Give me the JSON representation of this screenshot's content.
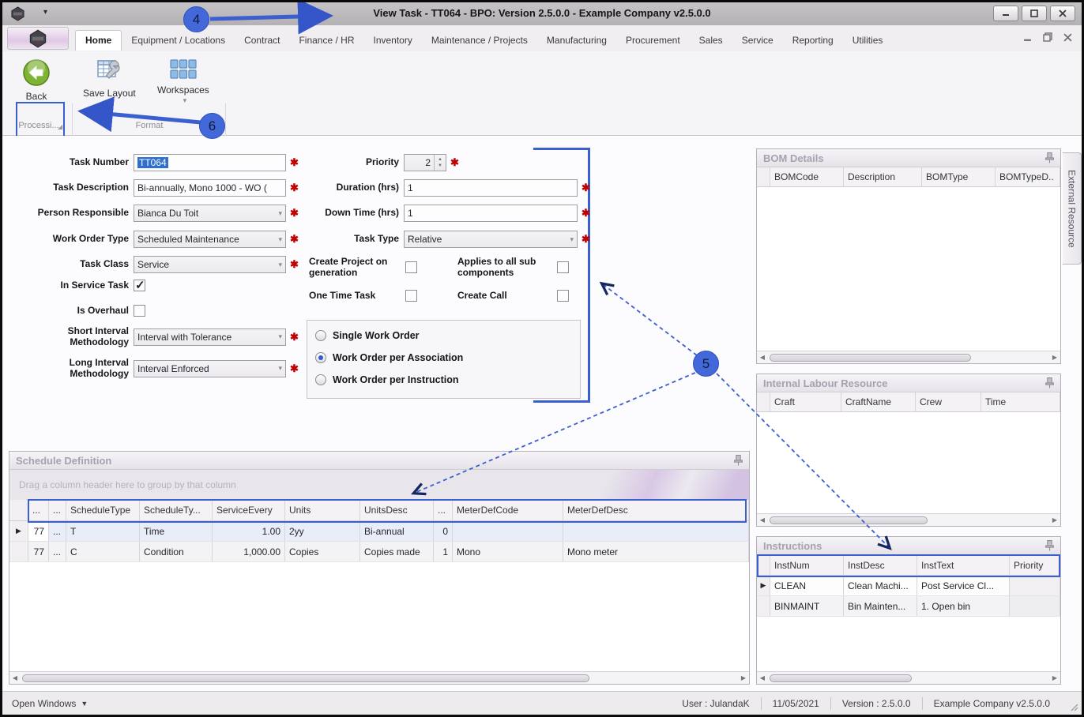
{
  "window": {
    "title": "View Task - TT064 - BPO: Version 2.5.0.0 - Example Company v2.5.0.0",
    "external_tab": "External Resource"
  },
  "tabs": {
    "items": [
      "Home",
      "Equipment / Locations",
      "Contract",
      "Finance / HR",
      "Inventory",
      "Maintenance / Projects",
      "Manufacturing",
      "Procurement",
      "Sales",
      "Service",
      "Reporting",
      "Utilities"
    ],
    "active": "Home"
  },
  "ribbon": {
    "back": "Back",
    "save_layout": "Save Layout",
    "workspaces": "Workspaces",
    "group_processing": "Processi...",
    "group_format": "Format"
  },
  "callouts": {
    "c4": "4",
    "c5": "5",
    "c6": "6"
  },
  "form": {
    "task_number": {
      "label": "Task Number",
      "value": "TT064"
    },
    "task_description": {
      "label": "Task Description",
      "value": "Bi-annually, Mono 1000 - WO ("
    },
    "person_responsible": {
      "label": "Person Responsible",
      "value": "Bianca Du Toit"
    },
    "work_order_type": {
      "label": "Work Order Type",
      "value": "Scheduled Maintenance"
    },
    "task_class": {
      "label": "Task Class",
      "value": "Service"
    },
    "in_service_task": {
      "label": "In Service Task",
      "checked": true
    },
    "is_overhaul": {
      "label": "Is Overhaul",
      "checked": false
    },
    "short_interval": {
      "label": "Short Interval Methodology",
      "value": "Interval with Tolerance"
    },
    "long_interval": {
      "label": "Long Interval Methodology",
      "value": "Interval Enforced"
    },
    "priority": {
      "label": "Priority",
      "value": "2"
    },
    "duration": {
      "label": "Duration (hrs)",
      "value": "1"
    },
    "down_time": {
      "label": "Down Time (hrs)",
      "value": "1"
    },
    "task_type": {
      "label": "Task Type",
      "value": "Relative"
    },
    "create_project": {
      "label": "Create Project on generation",
      "checked": false
    },
    "applies_sub": {
      "label": "Applies to all sub components",
      "checked": false
    },
    "one_time": {
      "label": "One Time Task",
      "checked": false
    },
    "create_call": {
      "label": "Create Call",
      "checked": false
    },
    "work_order_options": [
      "Single Work Order",
      "Work Order per Association",
      "Work Order per Instruction"
    ],
    "work_order_selected": "Work Order per Association"
  },
  "schedule": {
    "title": "Schedule Definition",
    "groupby_hint": "Drag a column header here to group by that column",
    "columns": [
      "...",
      "...",
      "ScheduleType",
      "ScheduleTy...",
      "ServiceEvery",
      "Units",
      "UnitsDesc",
      "...",
      "MeterDefCode",
      "MeterDefDesc"
    ],
    "rows": [
      [
        "77",
        "...",
        "T",
        "Time",
        "1.00",
        "2yy",
        "Bi-annual",
        "0",
        "",
        ""
      ],
      [
        "77",
        "...",
        "C",
        "Condition",
        "1,000.00",
        "Copies",
        "Copies made",
        "1",
        "Mono",
        "Mono meter"
      ]
    ]
  },
  "bom": {
    "title": "BOM Details",
    "columns": [
      "BOMCode",
      "Description",
      "BOMType",
      "BOMTypeD.."
    ]
  },
  "labour": {
    "title": "Internal Labour Resource",
    "columns": [
      "Craft",
      "CraftName",
      "Crew",
      "Time"
    ]
  },
  "instructions": {
    "title": "Instructions",
    "columns": [
      "InstNum",
      "InstDesc",
      "InstText",
      "Priority"
    ],
    "rows": [
      [
        "CLEAN",
        "Clean Machi...",
        "Post Service Cl...",
        ""
      ],
      [
        "BINMAINT",
        "Bin Mainten...",
        "1. Open bin",
        ""
      ]
    ]
  },
  "statusbar": {
    "open_windows": "Open Windows",
    "user": "User : JulandaK",
    "date": "11/05/2021",
    "version": "Version : 2.5.0.0",
    "company": "Example Company v2.5.0.0"
  },
  "colors": {
    "accent": "#3a5fd0",
    "required": "#c00000",
    "callout": "#4268d9"
  }
}
